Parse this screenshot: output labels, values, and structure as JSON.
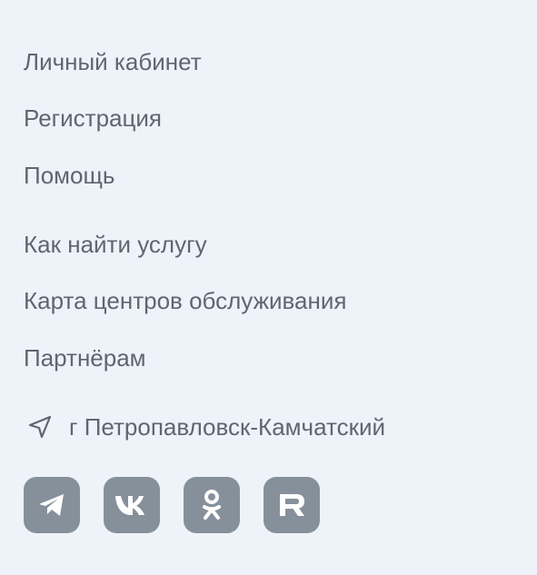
{
  "links": [
    {
      "label": "Личный кабинет"
    },
    {
      "label": "Регистрация"
    },
    {
      "label": "Помощь"
    },
    {
      "label": "Как найти услугу"
    },
    {
      "label": "Карта центров обслуживания"
    },
    {
      "label": "Партнёрам"
    }
  ],
  "location": {
    "icon": "location-arrow-icon",
    "city": "г Петропавловск-Камчатский"
  },
  "socials": [
    {
      "name": "telegram",
      "icon": "telegram-icon"
    },
    {
      "name": "vk",
      "icon": "vk-icon"
    },
    {
      "name": "odnoklassniki",
      "icon": "odnoklassniki-icon"
    },
    {
      "name": "rutube",
      "icon": "rutube-icon"
    }
  ],
  "colors": {
    "background": "#EEF3F9",
    "text": "#5E6670",
    "social_bg": "#86909B",
    "social_icon": "#FFFFFF"
  }
}
